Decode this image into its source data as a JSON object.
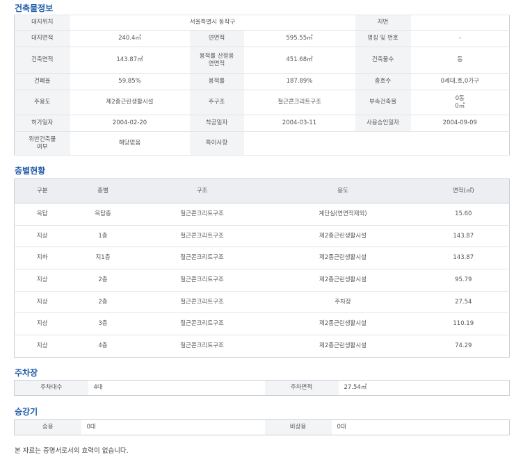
{
  "building_info": {
    "title": "건축물정보",
    "location_label": "대지위치",
    "location_value": "서울특별시 동작구",
    "lot_label": "지번",
    "lot_value": "",
    "site_area_label": "대지면적",
    "site_area_value": "240.4㎡",
    "floor_area_label": "연면적",
    "floor_area_value": "595.55㎡",
    "name_label": "명칭 및 번호",
    "name_value": "-",
    "building_area_label": "건축면적",
    "building_area_value": "143.87㎡",
    "far_area_label_1": "용적률 산정용",
    "far_area_label_2": "연면적",
    "far_area_value": "451.68㎡",
    "building_count_label": "건축물수",
    "building_count_value": "동",
    "bcr_label": "건폐율",
    "bcr_value": "59.85%",
    "far_label": "용적률",
    "far_value": "187.89%",
    "units_label": "총호수",
    "units_value": "0세대,호,0가구",
    "main_use_label": "주용도",
    "main_use_value": "제2종근린생활시설",
    "structure_label": "주구조",
    "structure_value": "철근콘크리트구조",
    "annex_label": "부속건축물",
    "annex_value_1": "0동",
    "annex_value_2": "0㎡",
    "permit_label": "허가일자",
    "permit_value": "2004-02-20",
    "start_label": "착공일자",
    "start_value": "2004-03-11",
    "approval_label": "사용승인일자",
    "approval_value": "2004-09-09",
    "violation_label_1": "위반건축물",
    "violation_label_2": "여부",
    "violation_value": "해당없음",
    "remarks_label": "특이사항",
    "remarks_value": ""
  },
  "floors": {
    "title": "층별현황",
    "headers": {
      "kind": "구분",
      "floor": "층별",
      "structure": "구조",
      "use": "용도",
      "area": "면적(㎡)"
    },
    "rows": [
      {
        "kind": "옥탑",
        "floor": "옥탑층",
        "structure": "철근콘크리트구조",
        "use": "계단실(연면적제외)",
        "area": "15.60"
      },
      {
        "kind": "지상",
        "floor": "1층",
        "structure": "철근콘크리트구조",
        "use": "제2종근린생활시설",
        "area": "143.87"
      },
      {
        "kind": "지하",
        "floor": "지1층",
        "structure": "철근콘크리트구조",
        "use": "제2종근린생활시설",
        "area": "143.87"
      },
      {
        "kind": "지상",
        "floor": "2층",
        "structure": "철근콘크리트구조",
        "use": "제2종근린생활시설",
        "area": "95.79"
      },
      {
        "kind": "지상",
        "floor": "2층",
        "structure": "철근콘크리트구조",
        "use": "주차장",
        "area": "27.54"
      },
      {
        "kind": "지상",
        "floor": "3층",
        "structure": "철근콘크리트구조",
        "use": "제2종근린생활시설",
        "area": "110.19"
      },
      {
        "kind": "지상",
        "floor": "4층",
        "structure": "철근콘크리트구조",
        "use": "제2종근린생활시설",
        "area": "74.29"
      }
    ]
  },
  "parking": {
    "title": "주차장",
    "count_label": "주차대수",
    "count_value": "4대",
    "area_label": "주차면적",
    "area_value": "27.54㎡"
  },
  "elevator": {
    "title": "승강기",
    "passenger_label": "승용",
    "passenger_value": "0대",
    "emergency_label": "비상용",
    "emergency_value": "0대"
  },
  "notice": "본 자료는 증명서로서의 효력이 없습니다."
}
